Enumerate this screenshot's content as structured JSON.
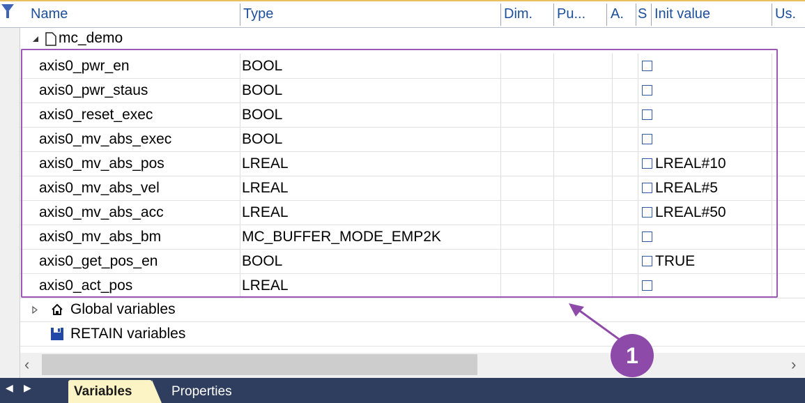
{
  "header": {
    "columns": [
      "Name",
      "Type",
      "Dim.",
      "Pu...",
      "A.",
      "S",
      "Init value",
      "Us."
    ]
  },
  "tree": {
    "file_node": "mc_demo",
    "global_node": "Global variables",
    "retain_node": "RETAIN variables"
  },
  "variables": [
    {
      "name": "axis0_pwr_en",
      "type": "BOOL",
      "init": ""
    },
    {
      "name": "axis0_pwr_staus",
      "type": "BOOL",
      "init": ""
    },
    {
      "name": "axis0_reset_exec",
      "type": "BOOL",
      "init": ""
    },
    {
      "name": "axis0_mv_abs_exec",
      "type": "BOOL",
      "init": ""
    },
    {
      "name": "axis0_mv_abs_pos",
      "type": "LREAL",
      "init": "LREAL#10"
    },
    {
      "name": "axis0_mv_abs_vel",
      "type": "LREAL",
      "init": "LREAL#5"
    },
    {
      "name": "axis0_mv_abs_acc",
      "type": "LREAL",
      "init": "LREAL#50"
    },
    {
      "name": "axis0_mv_abs_bm",
      "type": "MC_BUFFER_MODE_EMP2K",
      "init": ""
    },
    {
      "name": "axis0_get_pos_en",
      "type": "BOOL",
      "init": "TRUE"
    },
    {
      "name": "axis0_act_pos",
      "type": "LREAL",
      "init": ""
    }
  ],
  "tabs": {
    "active": "Variables",
    "other": "Properties"
  },
  "annotation": {
    "badge": "1"
  },
  "colors": {
    "highlight": "#9b59b6",
    "badge": "#8e4aa8",
    "tabbar": "#2f3e5f",
    "active_tab": "#fdf4c5"
  }
}
